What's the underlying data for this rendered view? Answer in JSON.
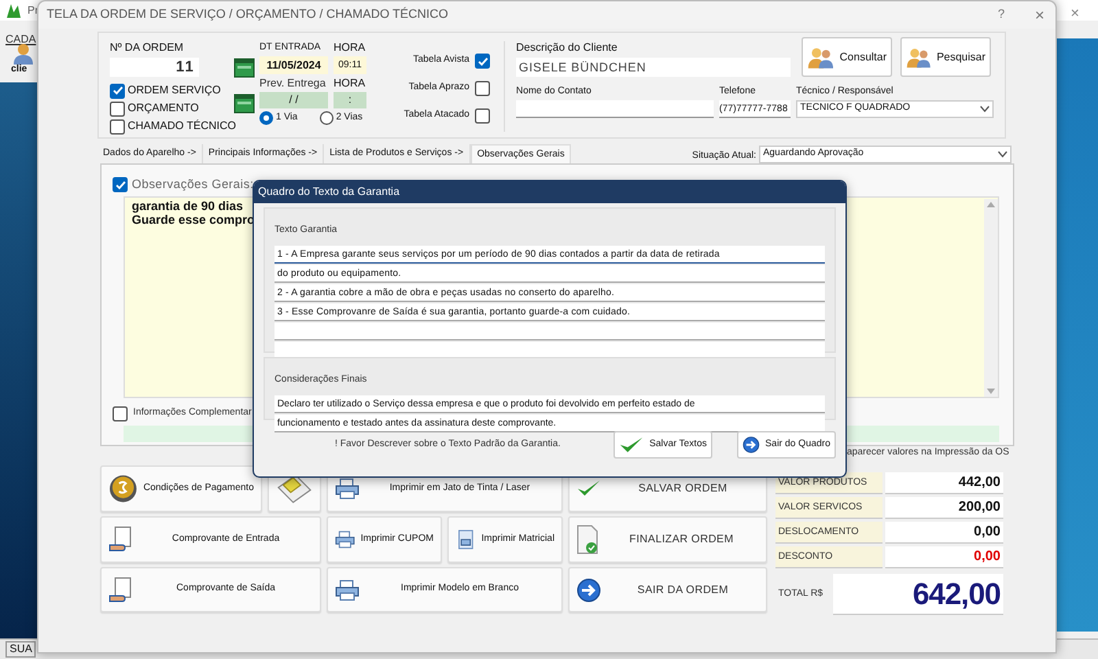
{
  "background_app": {
    "title": "Pr",
    "menu": "CADA",
    "toolbar_label": "clie",
    "status": "SUA",
    "close": "×"
  },
  "window": {
    "title": "TELA DA ORDEM DE SERVIÇO / ORÇAMENTO / CHAMADO TÉCNICO",
    "help": "?",
    "close": "×"
  },
  "order": {
    "label": "Nº DA ORDEM",
    "number": "11",
    "types": [
      {
        "label": "ORDEM SERVIÇO",
        "checked": true
      },
      {
        "label": "ORÇAMENTO",
        "checked": false
      },
      {
        "label": "CHAMADO TÉCNICO",
        "checked": false
      }
    ]
  },
  "dates": {
    "entry_label": "DT ENTRADA",
    "entry_hour_label": "HORA",
    "entry_date": "11/05/2024",
    "entry_hour": "09:11",
    "forecast_label": "Prev. Entrega",
    "forecast_hour_label": "HORA",
    "forecast_date": "/ /",
    "forecast_hour": ":",
    "copies": [
      {
        "label": "1 Via",
        "selected": true
      },
      {
        "label": "2 Vias",
        "selected": false
      }
    ]
  },
  "price_tables": [
    {
      "label": "Tabela Avista",
      "checked": true
    },
    {
      "label": "Tabela Aprazo",
      "checked": false
    },
    {
      "label": "Tabela Atacado",
      "checked": false
    }
  ],
  "client": {
    "description_label": "Descrição do Cliente",
    "description": "GISELE BÜNDCHEN",
    "buttons": [
      "Consultar",
      "Pesquisar"
    ],
    "contact_label": "Nome do Contato",
    "phone_label": "Telefone",
    "phone": "(77)77777-7788",
    "technician_label": "Técnico / Responsável",
    "technician": "TECNICO F QUADRADO"
  },
  "tabs": [
    {
      "label": "Dados do Aparelho ->",
      "selected": false
    },
    {
      "label": "Principais Informações ->",
      "selected": false
    },
    {
      "label": "Lista de Produtos e Serviços ->",
      "selected": false
    },
    {
      "label": "Observações Gerais",
      "selected": true
    }
  ],
  "status": {
    "label": "Situação Atual:",
    "value": "Aguardando Aprovação"
  },
  "observations": {
    "label": "Observações Gerais:",
    "checked": true,
    "lines": [
      "garantia de 90 dias",
      "Guarde esse compro"
    ]
  },
  "complementary": {
    "label": "Informações Complementar",
    "checked": false
  },
  "dialog": {
    "title": "Quadro do Texto da Garantia",
    "warranty_label": "Texto Garantia",
    "warranty_lines": [
      "1 - A Empresa garante seus serviços por um período de 90 dias contados a partir da data de retirada",
      "do produto ou equipamento.",
      "2 - A garantia cobre a mão de obra e peças usadas no conserto do aparelho.",
      "3 - Esse Comprovanre de Saída é sua garantia, portanto guarde-a com cuidado."
    ],
    "final_label": "Considerações Finais",
    "final_lines": [
      "Declaro ter utilizado o Serviço dessa empresa e que o produto foi devolvido em perfeito estado de",
      "funcionamento e testado antes da assinatura deste comprovante."
    ],
    "hint": "! Favor Descrever sobre o Texto Padrão da Garantia.",
    "buttons": [
      {
        "label": "Salvar Textos",
        "kind": "save"
      },
      {
        "label": "Sair do Quadro",
        "kind": "exit"
      }
    ]
  },
  "print_note": "aparecer valores na Impressão da OS",
  "actions": [
    {
      "label": "Condições de Pagamento",
      "kind": "coin"
    },
    {
      "kind": "notes"
    },
    {
      "label": "Imprimir em Jato de Tinta / Laser",
      "kind": "printer"
    },
    {
      "label": "SALVAR ORDEM",
      "kind": "check"
    },
    {
      "label": "Comprovante de Entrada",
      "kind": "doc-hand"
    },
    {
      "label": "Imprimir CUPOM",
      "kind": "printer"
    },
    {
      "label": "Imprimir Matricial",
      "kind": "doc-printer"
    },
    {
      "label": "FINALIZAR ORDEM",
      "kind": "doc-check"
    },
    {
      "label": "Comprovante de Saída",
      "kind": "doc-hand"
    },
    {
      "label": "Imprimir Modelo em Branco",
      "kind": "printer"
    },
    {
      "label": "SAIR DA ORDEM",
      "kind": "exit"
    }
  ],
  "totals": [
    {
      "label": "VALOR PRODUTOS",
      "value": "442,00",
      "kind": "addition"
    },
    {
      "label": "VALOR SERVICOS",
      "value": "200,00",
      "kind": "addition"
    },
    {
      "label": "DESLOCAMENTO",
      "value": "0,00",
      "kind": "addition"
    },
    {
      "label": "DESCONTO",
      "value": "0,00",
      "kind": "deduction"
    }
  ],
  "total": {
    "label": "TOTAL R$",
    "value": "642,00"
  }
}
